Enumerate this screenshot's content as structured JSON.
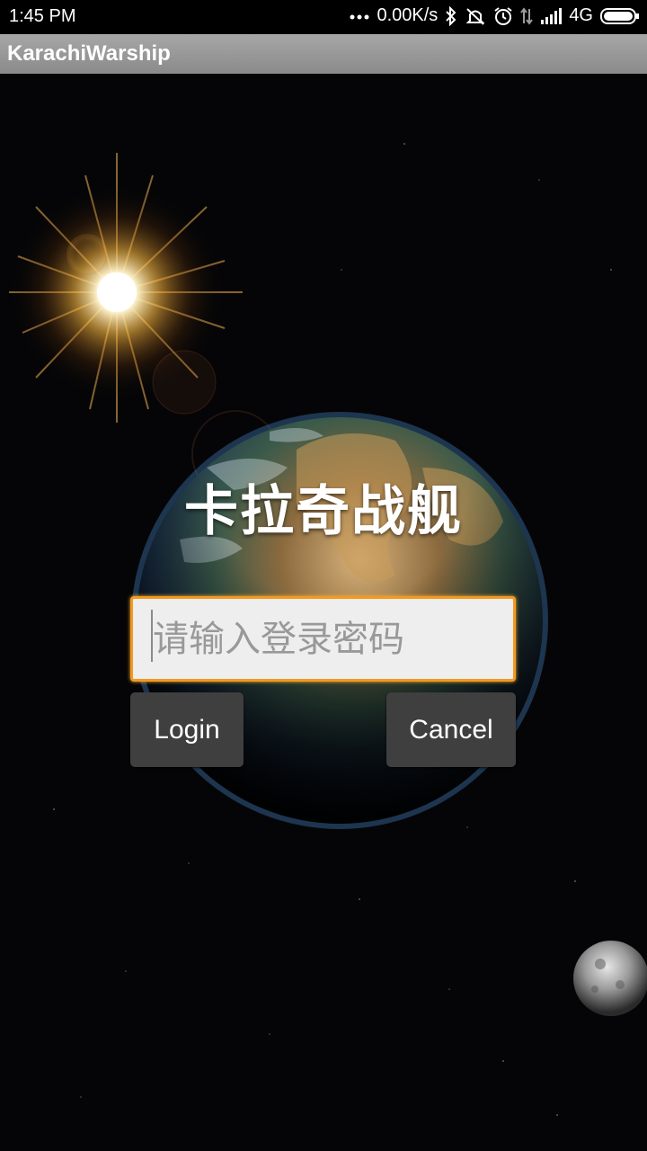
{
  "status_bar": {
    "time": "1:45  PM",
    "network_speed": "0.00K/s",
    "network_type": "4G",
    "icons": [
      "dots-icon",
      "bluetooth-icon",
      "mute-icon",
      "alarm-icon",
      "data-arrows-icon",
      "signal-icon",
      "battery-icon"
    ]
  },
  "app_bar": {
    "title": "KarachiWarship"
  },
  "login": {
    "title": "卡拉奇战舰",
    "password_placeholder": "请输入登录密码",
    "password_value": "",
    "login_label": "Login",
    "cancel_label": "Cancel"
  },
  "colors": {
    "input_focus_border": "#f39a1f",
    "button_bg": "#3f3f3f",
    "app_bar_bg": "#9a9a9a"
  }
}
